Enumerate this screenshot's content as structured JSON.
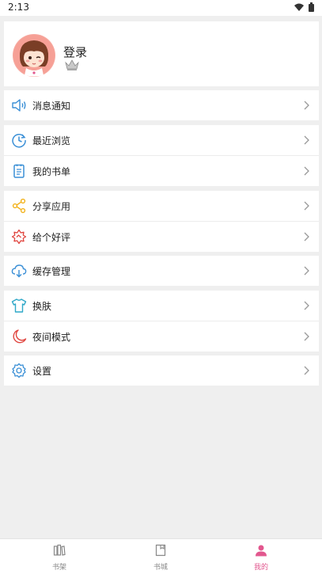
{
  "status": {
    "time": "2:13"
  },
  "profile": {
    "login_label": "登录"
  },
  "menu": {
    "notify": "消息通知",
    "recent": "最近浏览",
    "booklist": "我的书单",
    "share": "分享应用",
    "rate": "给个好评",
    "cache": "缓存管理",
    "skin": "换肤",
    "night": "夜间模式",
    "settings": "设置"
  },
  "tabs": [
    {
      "label": "书架",
      "icon": "bookshelf-icon"
    },
    {
      "label": "书城",
      "icon": "bookstore-icon"
    },
    {
      "label": "我的",
      "icon": "user-icon"
    }
  ],
  "colors": {
    "accent": "#e2578e",
    "notify_icon": "#3a8fd6",
    "share_icon": "#f2b21c",
    "rate_icon": "#e0453f",
    "skin_icon": "#2fa8c8",
    "night_icon": "#e0453f"
  }
}
